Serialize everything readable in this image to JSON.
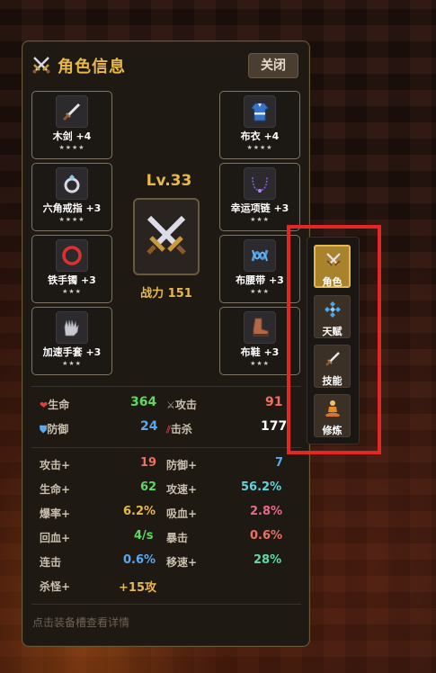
{
  "header": {
    "title": "角色信息",
    "close_label": "关闭"
  },
  "equipment_left": [
    {
      "name": "木剑 +4",
      "stars": "★★★★",
      "icon": "dagger-icon"
    },
    {
      "name": "六角戒指 +3",
      "stars": "★★★★",
      "icon": "ring-icon"
    },
    {
      "name": "铁手镯 +3",
      "stars": "★★★",
      "icon": "bracelet-icon"
    },
    {
      "name": "加速手套 +3",
      "stars": "★★★",
      "icon": "gloves-icon"
    }
  ],
  "equipment_right": [
    {
      "name": "布衣 +4",
      "stars": "★★★★",
      "icon": "robe-icon"
    },
    {
      "name": "幸运项链 +3",
      "stars": "★★★",
      "icon": "necklace-icon"
    },
    {
      "name": "布腰带 +3",
      "stars": "★★★",
      "icon": "belt-icon"
    },
    {
      "name": "布鞋 +3",
      "stars": "★★★",
      "icon": "boots-icon"
    }
  ],
  "character": {
    "level": "Lv.33",
    "power": "战力 151"
  },
  "main_stats": [
    {
      "label": "生命",
      "value": "364",
      "color": "#5ed95e",
      "icon": "heart-icon"
    },
    {
      "label": "攻击",
      "value": "91",
      "color": "#f07060",
      "icon": "crossed-swords-icon"
    },
    {
      "label": "防御",
      "value": "24",
      "color": "#5aa8f0",
      "icon": "shield-icon"
    },
    {
      "label": "击杀",
      "value": "177",
      "color": "#ffffff",
      "icon": "claw-icon"
    }
  ],
  "bonus_stats": [
    {
      "label": "攻击+",
      "value": "19",
      "color": "#f07060"
    },
    {
      "label": "防御+",
      "value": "7",
      "color": "#5aa8f0"
    },
    {
      "label": "生命+",
      "value": "62",
      "color": "#5ed95e"
    },
    {
      "label": "攻速+",
      "value": "56.2%",
      "color": "#5fd3e0"
    },
    {
      "label": "爆率+",
      "value": "6.2%",
      "color": "#e8b84a"
    },
    {
      "label": "吸血+",
      "value": "2.8%",
      "color": "#e86a8a"
    },
    {
      "label": "回血+",
      "value": "4/s",
      "color": "#5ed95e"
    },
    {
      "label": "暴击",
      "value": "0.6%",
      "color": "#f07060"
    },
    {
      "label": "连击",
      "value": "0.6%",
      "color": "#5aa8f0"
    },
    {
      "label": "移速+",
      "value": "28%",
      "color": "#5ed9a8"
    },
    {
      "label": "杀怪+",
      "value": "+15攻",
      "color": "#e8b84a"
    }
  ],
  "hint": "点击装备槽查看详情",
  "tabs": [
    {
      "label": "角色",
      "icon": "crossed-swords-icon",
      "active": true
    },
    {
      "label": "天赋",
      "icon": "diamond-cluster-icon",
      "active": false
    },
    {
      "label": "技能",
      "icon": "dagger-icon",
      "active": false
    },
    {
      "label": "修炼",
      "icon": "meditation-icon",
      "active": false
    }
  ]
}
